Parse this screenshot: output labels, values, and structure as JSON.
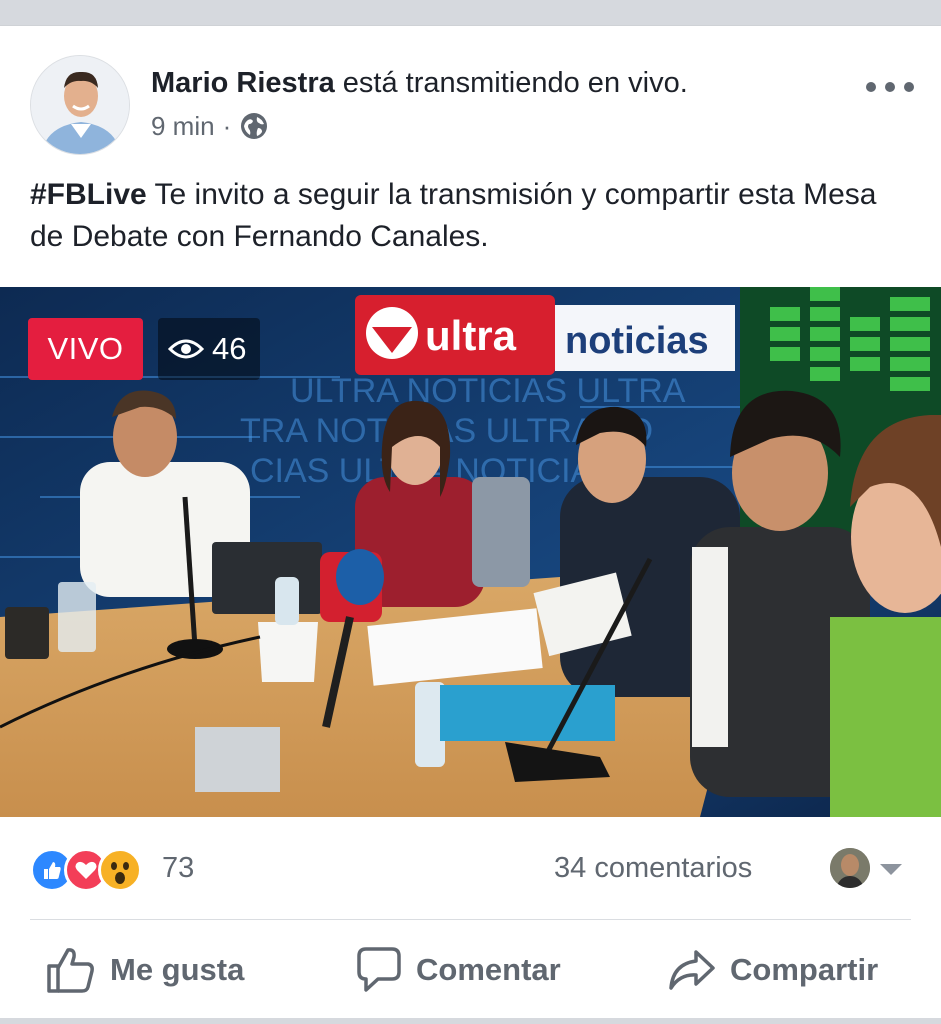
{
  "post": {
    "author": "Mario Riestra",
    "action_text": "está transmitiendo en vivo.",
    "time": "9 min",
    "separator": "·",
    "hashtag": "#FBLive",
    "body": "Te invito a seguir la transmisión y compartir esta Mesa de Debate con Fernando Canales."
  },
  "video": {
    "live_label": "VIVO",
    "viewer_count": "46",
    "overlay_text": "ultra noticias",
    "overlay_brand": "ultra",
    "overlay_sub": "noticias"
  },
  "reactions": {
    "count": "73",
    "comments": "34 comentarios",
    "types": [
      "like",
      "love",
      "wow"
    ]
  },
  "actions": {
    "like": "Me gusta",
    "comment": "Comentar",
    "share": "Compartir"
  },
  "colors": {
    "live": "#e41e3f",
    "text": "#1d2129",
    "secondary": "#606770",
    "like_blue": "#2d88ff",
    "love_red": "#f33e58",
    "wow_yellow": "#f7b125"
  }
}
